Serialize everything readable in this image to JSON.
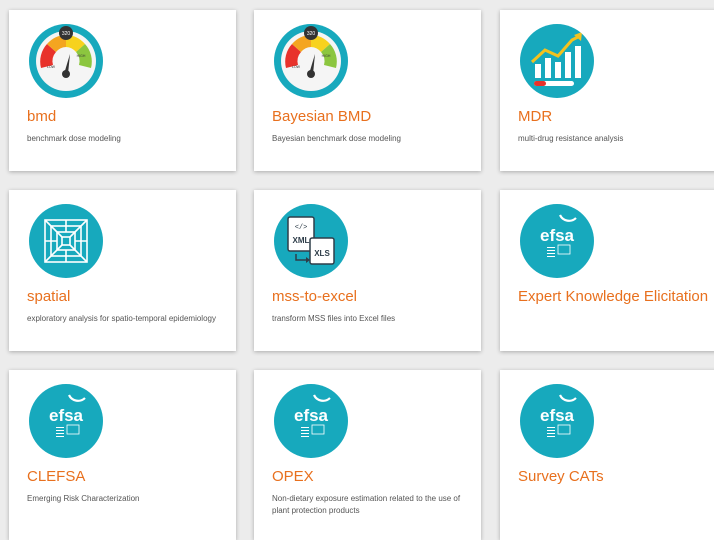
{
  "theme": {
    "accent": "#e8701e",
    "icon_bg": "#17a9bd",
    "card_bg": "#ffffff",
    "page_bg": "#ececec"
  },
  "cards": [
    {
      "title": "bmd",
      "description": "benchmark dose modeling",
      "icon": "gauge-icon"
    },
    {
      "title": "Bayesian BMD",
      "description": "Bayesian benchmark dose modeling",
      "icon": "gauge-icon"
    },
    {
      "title": "MDR",
      "description": "multi-drug resistance analysis",
      "icon": "growth-chart-icon"
    },
    {
      "title": "spatial",
      "description": "exploratory analysis for spatio-temporal epidemiology",
      "icon": "spatial-grid-icon"
    },
    {
      "title": "mss-to-excel",
      "description": "transform MSS files into Excel files",
      "icon": "xml-to-xls-icon"
    },
    {
      "title": "Expert Knowledge Elicitation",
      "description": "",
      "icon": "efsa-logo-icon"
    },
    {
      "title": "CLEFSA",
      "description": "Emerging Risk Characterization",
      "icon": "efsa-logo-icon"
    },
    {
      "title": "OPEX",
      "description": "Non-dietary exposure estimation related to the use of plant protection products",
      "icon": "efsa-logo-icon"
    },
    {
      "title": "Survey CATs",
      "description": "",
      "icon": "efsa-logo-icon"
    }
  ],
  "icon_text": {
    "gauge_value": "320",
    "gauge_high": "HIGH",
    "gauge_low": "LOW",
    "efsa_brand": "efsa",
    "xml_label": "XML",
    "xls_label": "XLS",
    "code_glyph": "</>"
  }
}
